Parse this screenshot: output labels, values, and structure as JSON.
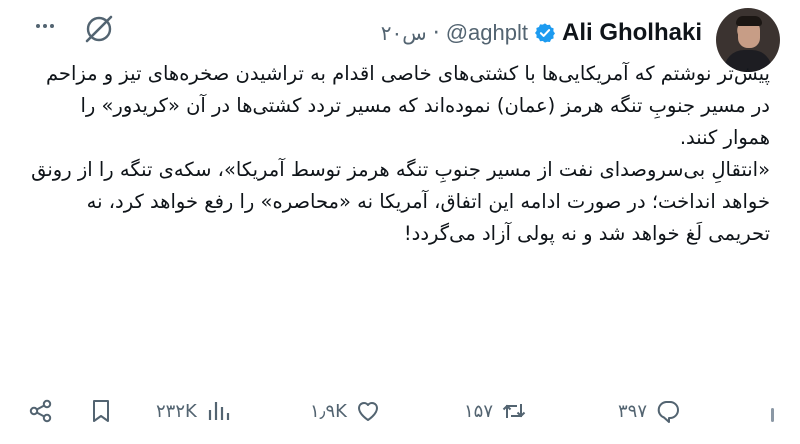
{
  "tweet": {
    "author_name": "Ali Gholhaki",
    "handle": "@aghplt",
    "separator": "·",
    "timestamp": "۲۰س",
    "body": "پیش‌تر نوشتم که آمریکایی‌ها با کشتی‌های خاصی اقدام به تراشیدن صخره‌های تیز و مزاحم در مسیر جنوبِ تنگه هرمز (عمان) نموده‌اند که مسیر تردد کشتی‌ها در آن «کریدور» را هموار کنند.\n«انتقالِ بی‌سروصدای نفت از مسیر جنوبِ تنگه هرمز توسط آمریکا»، سکه‌ی تنگه را از رونق خواهد انداخت؛ در صورت ادامه این اتفاق، آمریکا نه «محاصره» را رفع خواهد کرد، نه تحریمی لَغ خواهد شد و نه پولی آزاد می‌گردد!",
    "verified_color": "#1d9bf0"
  },
  "actions": {
    "views": "۲۳۲K",
    "likes": "۱٫۹K",
    "retweets": "۱۵۷",
    "replies": "۳۹۷"
  },
  "icons": [
    "avatar",
    "verified-badge-icon",
    "grok-icon",
    "more-options-icon",
    "share-icon",
    "bookmark-icon",
    "views-icon",
    "like-icon",
    "retweet-icon",
    "reply-icon"
  ]
}
